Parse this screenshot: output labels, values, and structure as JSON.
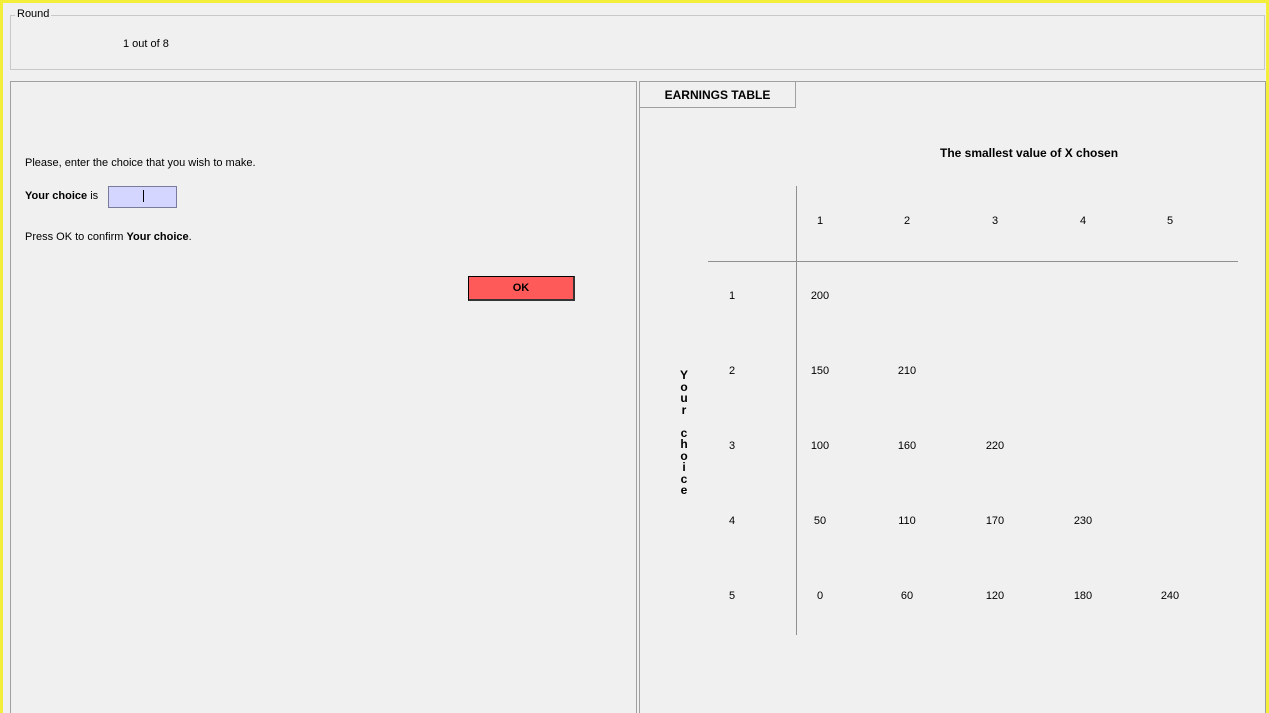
{
  "round": {
    "legend": "Round",
    "value": "1 out of 8"
  },
  "left_panel": {
    "instruction": "Please, enter the choice that you wish to make.",
    "choice_label_bold": "Your choice",
    "choice_label_rest": " is",
    "choice_value": "",
    "confirm_prefix": "Press OK to confirm ",
    "confirm_bold": "Your choice",
    "confirm_suffix": ".",
    "ok_label": "OK"
  },
  "right_panel": {
    "tab_label": "EARNINGS TABLE",
    "table_title": "The smallest value of X chosen",
    "side_label": "Y\no\nu\nr\n\nc\nh\no\ni\nc\ne",
    "column_headers": [
      "1",
      "2",
      "3",
      "4",
      "5"
    ],
    "row_headers": [
      "1",
      "2",
      "3",
      "4",
      "5"
    ],
    "rows": [
      [
        "200",
        "",
        "",
        "",
        ""
      ],
      [
        "150",
        "210",
        "",
        "",
        ""
      ],
      [
        "100",
        "160",
        "220",
        "",
        ""
      ],
      [
        "50",
        "110",
        "170",
        "230",
        ""
      ],
      [
        "0",
        "60",
        "120",
        "180",
        "240"
      ]
    ]
  },
  "colors": {
    "frame": "#f2ee3a",
    "ok_button": "#ff5a5a",
    "input_bg": "#d4d6ff"
  }
}
